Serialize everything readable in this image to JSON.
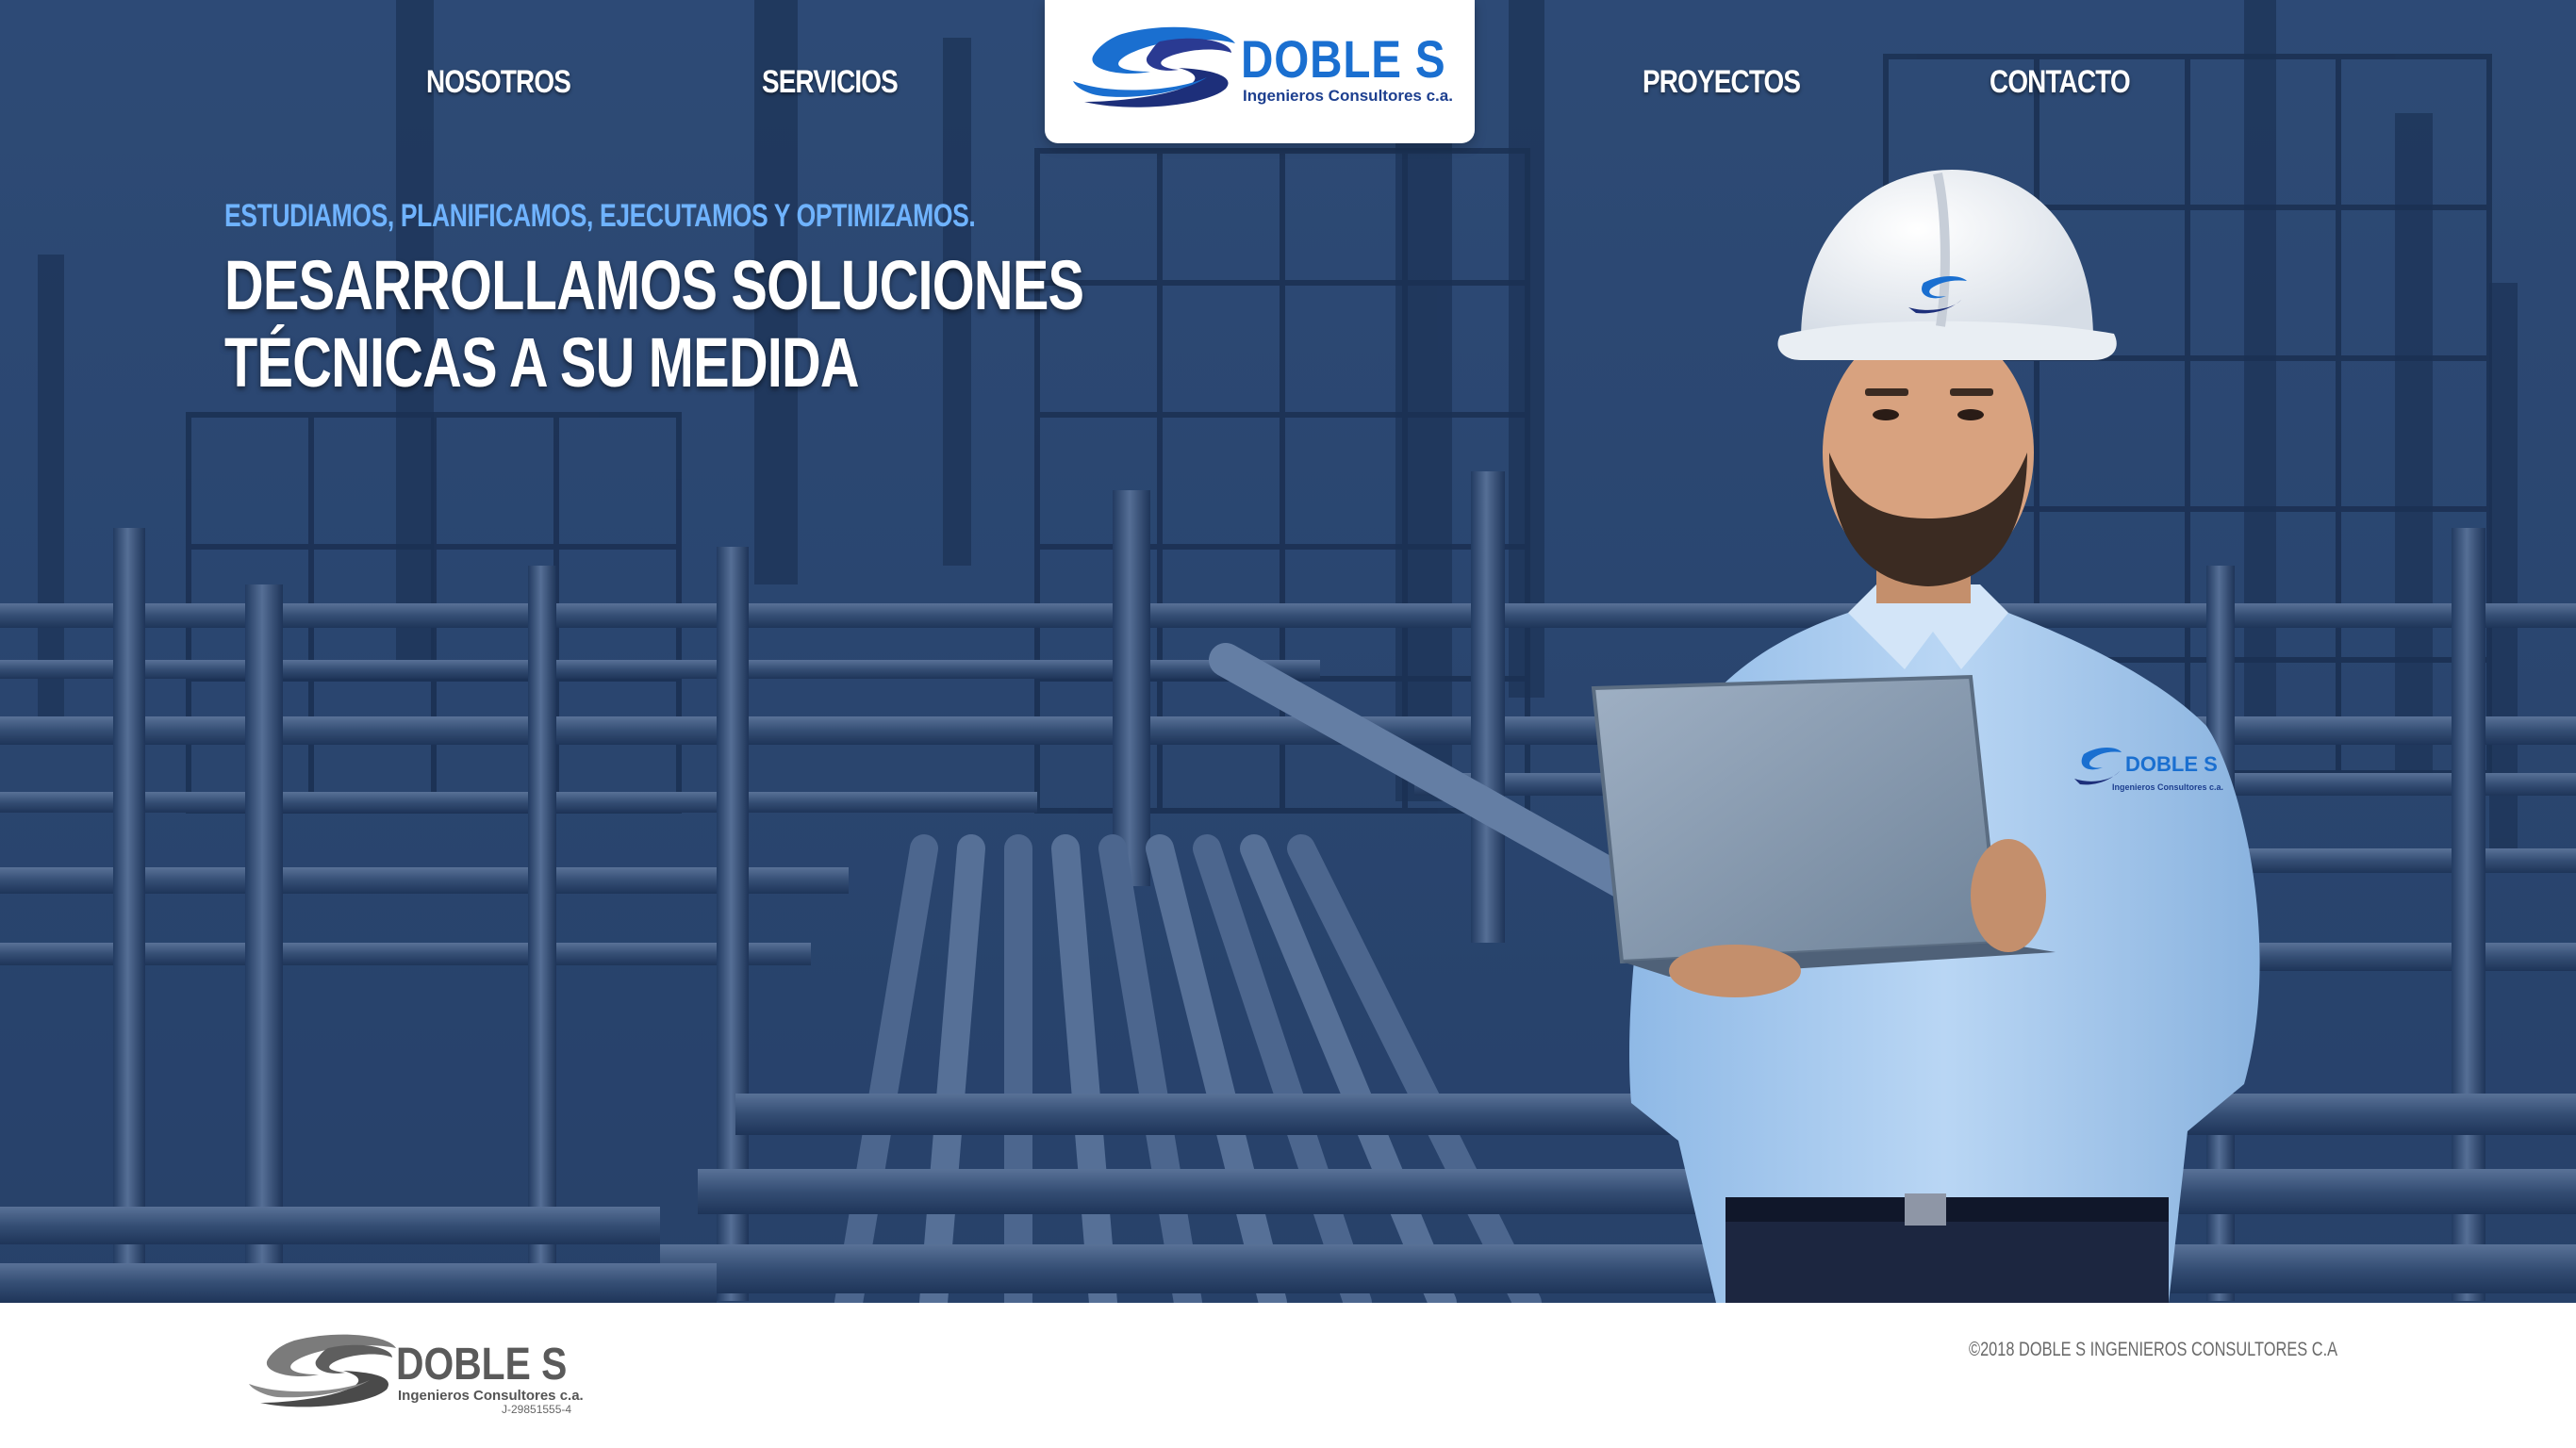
{
  "nav": {
    "items": [
      {
        "label": "NOSOTROS"
      },
      {
        "label": "SERVICIOS"
      },
      {
        "label": "PROYECTOS"
      },
      {
        "label": "CONTACTO"
      }
    ]
  },
  "logo": {
    "name": "DOBLE S",
    "tagline": "Ingenieros Consultores c.a."
  },
  "hero": {
    "subtitle": "ESTUDIAMOS, PLANIFICAMOS, EJECUTAMOS Y OPTIMIZAMOS.",
    "title": "DESARROLLAMOS SOLUCIONES TÉCNICAS A SU MEDIDA"
  },
  "shirt_logo": {
    "name": "DOBLE S",
    "tagline": "Ingenieros Consultores c.a."
  },
  "footer": {
    "logo_name": "DOBLE S",
    "logo_tagline": "Ingenieros Consultores c.a.",
    "rif": "J-29851555-4",
    "copyright": "©2018 DOBLE S INGENIEROS CONSULTORES C.A"
  },
  "colors": {
    "brand_blue": "#1a6fd0",
    "hero_overlay": "#2b466f",
    "accent_light_blue": "#6fb3ff"
  },
  "icons": [
    "doble-s-logo-icon",
    "footer-logo-icon",
    "helmet-logo-icon"
  ]
}
